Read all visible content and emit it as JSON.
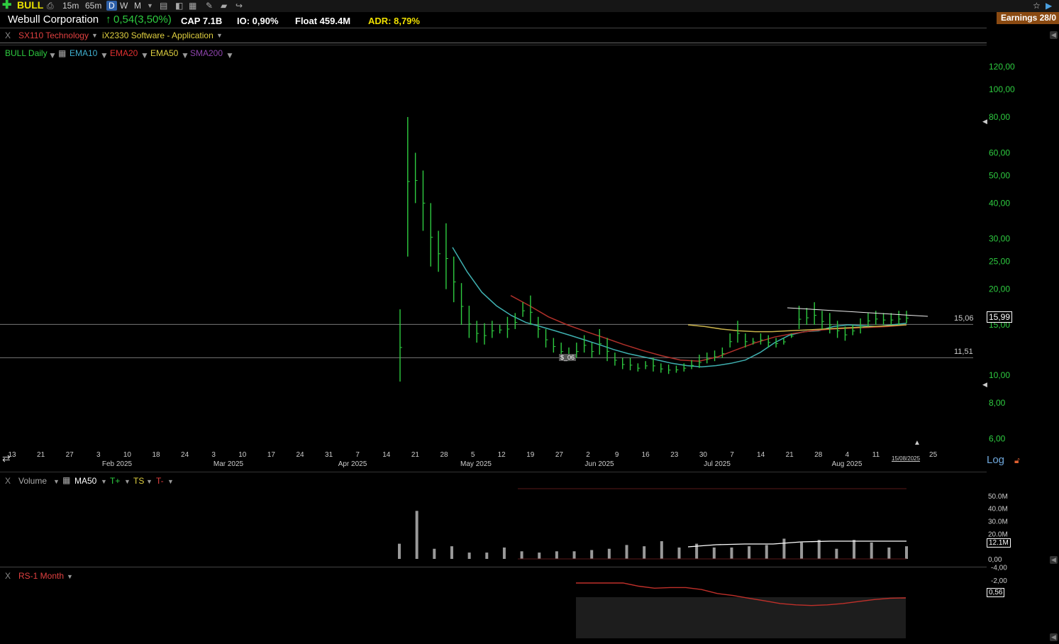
{
  "toolbar": {
    "symbol": "BULL",
    "intervals": [
      "15m",
      "65m",
      "D",
      "W",
      "M"
    ],
    "active_interval": "D",
    "earnings": "Earnings 28/0"
  },
  "info": {
    "company": "Webull Corporation",
    "change": "0,54(3,50%)",
    "cap": "CAP 7.1B",
    "io": "IO: 0,90%",
    "float": "Float 459.4M",
    "adr": "ADR: 8,79%"
  },
  "sector": {
    "close": "X",
    "sector": "SX110 Technology",
    "industry": "iX2330 Software - Application"
  },
  "legend": {
    "main": "BULL Daily",
    "ema10": "EMA10",
    "ema20": "EMA20",
    "ema50": "EMA50",
    "sma200": "SMA200"
  },
  "volume_panel": {
    "close": "X",
    "title": "Volume",
    "ma": "MA50",
    "t_plus": "T+",
    "ts": "TS",
    "t_minus": "T-",
    "current": "12.1M"
  },
  "rs_panel": {
    "close": "X",
    "title": "RS-1 Month",
    "current": "0,56"
  },
  "price_label": "15,99",
  "line_labels": {
    "upper": "15,06",
    "lower": "11,51",
    "note": "$_06"
  },
  "log_label": "Log",
  "date_label": "15/08/2025",
  "colors": {
    "up": "#2ecc40",
    "ema10": "#3fb0b0",
    "ema20": "#b0302a",
    "ema50": "#c9b24a",
    "sma200": "#8e44ad"
  },
  "chart_data": {
    "type": "bar",
    "scale": "log",
    "ylim": [
      5.5,
      130
    ],
    "y_ticks": [
      "120,00",
      "100,00",
      "80,00",
      "60,00",
      "50,00",
      "40,00",
      "30,00",
      "25,00",
      "20,00",
      "15,00",
      "10,00",
      "8,00",
      "6,00"
    ],
    "y_tick_values": [
      120,
      100,
      80,
      60,
      50,
      40,
      30,
      25,
      20,
      15,
      10,
      8,
      6
    ],
    "x_tick_labels": [
      "13",
      "21",
      "27",
      "3",
      "10",
      "18",
      "24",
      "3",
      "10",
      "17",
      "24",
      "31",
      "7",
      "14",
      "21",
      "28",
      "5",
      "12",
      "19",
      "27",
      "2",
      "9",
      "16",
      "23",
      "30",
      "7",
      "14",
      "21",
      "28",
      "4",
      "11",
      "25"
    ],
    "months": [
      "Feb 2025",
      "Mar 2025",
      "Apr 2025",
      "May 2025",
      "Jun 2025",
      "Jul 2025",
      "Aug 2025"
    ],
    "horizontal_lines": [
      15.06,
      11.51
    ],
    "bars_high": [
      17.0,
      80.0,
      60.0,
      52.0,
      40.0,
      32.0,
      34.0,
      26.0,
      21.0,
      17.5,
      15.5,
      15.2,
      15.5,
      15.0,
      16.0,
      16.5,
      18.0,
      19.0,
      16.0,
      14.5,
      13.5,
      13.0,
      12.5,
      13.0,
      13.8,
      13.0,
      14.5,
      13.5,
      12.0,
      11.5,
      11.5,
      11.0,
      11.2,
      11.5,
      11.0,
      10.9,
      10.8,
      11.0,
      11.3,
      11.8,
      12.0,
      12.2,
      12.5,
      14.0,
      15.5,
      14.0,
      13.5,
      14.0,
      13.8,
      13.5,
      13.5,
      14.0,
      17.5,
      17.2,
      18.0,
      16.8,
      16.5,
      15.5,
      14.8,
      15.0,
      15.8,
      16.5,
      16.8,
      16.5,
      16.5,
      16.8,
      16.8
    ],
    "bars_low": [
      9.5,
      26.0,
      40.0,
      32.0,
      24.0,
      23.0,
      20.0,
      18.0,
      15.0,
      13.5,
      13.0,
      12.8,
      13.5,
      14.0,
      13.5,
      14.5,
      16.0,
      15.0,
      13.5,
      12.5,
      12.0,
      11.5,
      11.2,
      11.5,
      12.0,
      11.5,
      11.8,
      11.2,
      10.8,
      10.5,
      10.4,
      10.3,
      10.5,
      10.3,
      10.2,
      10.1,
      10.2,
      10.3,
      10.5,
      10.6,
      11.0,
      11.2,
      11.5,
      12.5,
      13.0,
      12.5,
      12.8,
      12.8,
      12.5,
      12.5,
      12.8,
      13.5,
      14.5,
      15.0,
      15.0,
      14.5,
      14.0,
      13.5,
      13.2,
      13.8,
      14.0,
      14.8,
      15.0,
      15.0,
      15.0,
      15.0,
      15.2
    ],
    "ema10": [
      28,
      23,
      19.5,
      17.5,
      16.2,
      15.3,
      14.8,
      14.3,
      13.8,
      13.3,
      12.8,
      12.3,
      11.9,
      11.6,
      11.3,
      11.0,
      10.8,
      10.7,
      10.8,
      11.0,
      11.3,
      12.0,
      13.0,
      13.8,
      14.2,
      14.3,
      14.8,
      15.0,
      14.9,
      14.8,
      15.0,
      15.2
    ],
    "ema20": [
      19.0,
      17.5,
      16.0,
      15.0,
      14.2,
      13.5,
      12.8,
      12.2,
      11.7,
      11.3,
      11.2,
      11.6,
      12.3,
      13.0,
      13.6,
      14.0,
      14.3,
      14.5,
      14.6,
      14.7,
      14.8,
      15.0
    ],
    "ema50": [
      15.0,
      14.8,
      14.5,
      14.3,
      14.2,
      14.2,
      14.3,
      14.4,
      14.5,
      14.6,
      14.7,
      14.8,
      14.9,
      15.0
    ],
    "volume": [
      12,
      38,
      8,
      10,
      5,
      5,
      9,
      6,
      5,
      6,
      6,
      7,
      8,
      11,
      10,
      14,
      9,
      12,
      9,
      9,
      10,
      11,
      16,
      13,
      15,
      8,
      15,
      13,
      9,
      10
    ],
    "volume_ylim": [
      0,
      55
    ],
    "volume_ticks": [
      "50.0M",
      "40.0M",
      "30.0M",
      "20.0M",
      "0,00"
    ],
    "rs_ticks": [
      "0,56",
      "-2,00",
      "-4,00"
    ],
    "rs": [
      -4.5,
      -3.2,
      -2.4,
      -1.8,
      -1.2,
      -0.9,
      -1.0,
      -1.0,
      -0.7,
      -0.1,
      0.2,
      0.6,
      1.0,
      1.4,
      1.6,
      1.7,
      1.6,
      1.4,
      1.1,
      0.8,
      0.6,
      0.56
    ]
  }
}
